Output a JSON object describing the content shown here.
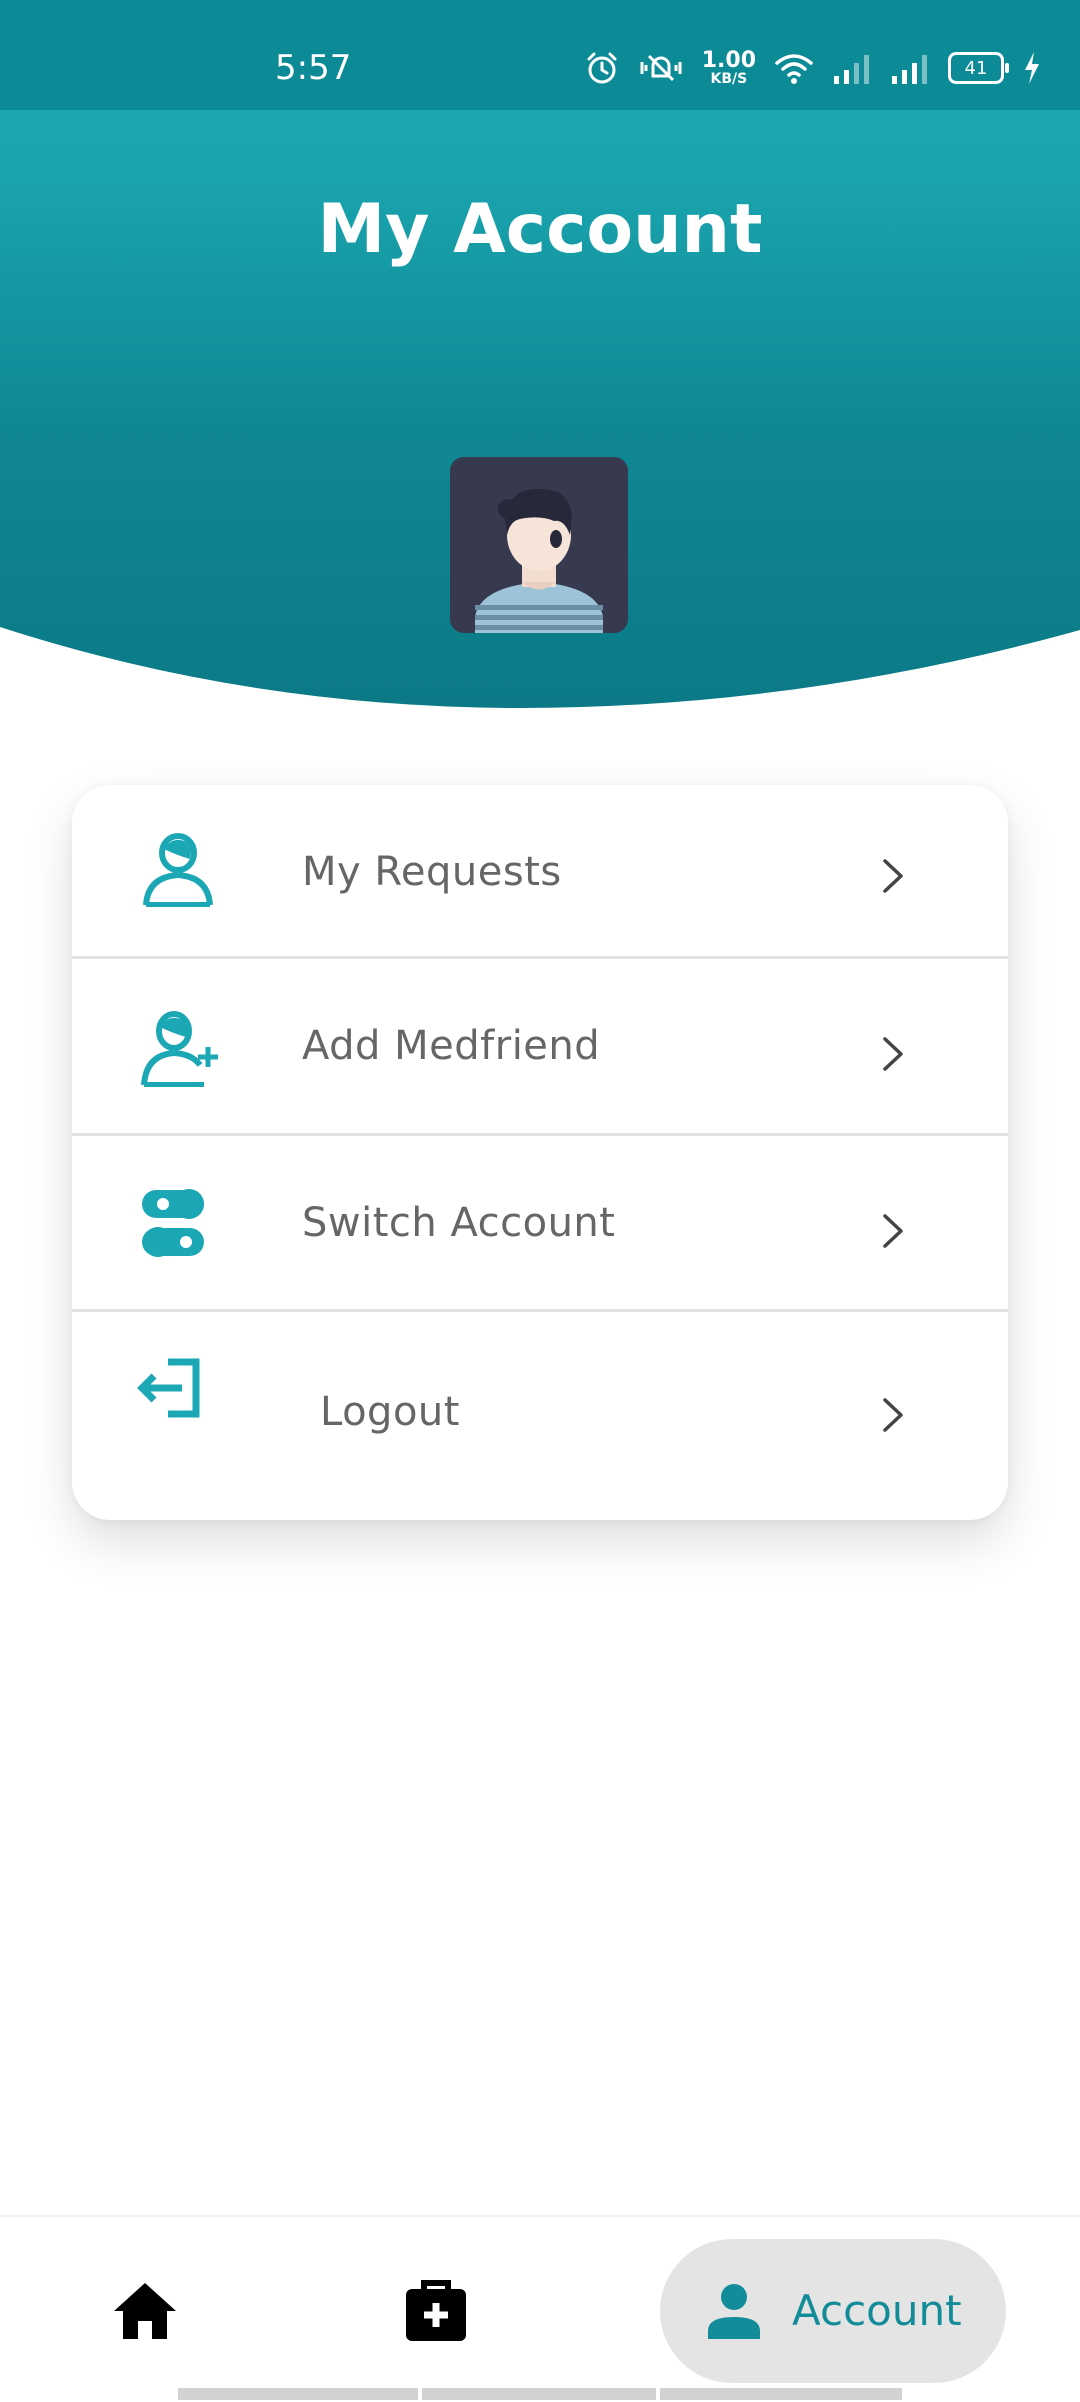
{
  "status_bar": {
    "time": "5:57",
    "net_speed_value": "1.00",
    "net_speed_unit": "KB/S",
    "battery_level": "41"
  },
  "header": {
    "title": "My Account"
  },
  "menu": {
    "items": [
      {
        "label": "My Requests",
        "icon": "user-icon"
      },
      {
        "label": "Add Medfriend",
        "icon": "add-user-icon"
      },
      {
        "label": "Switch Account",
        "icon": "toggle-icon"
      },
      {
        "label": "Logout",
        "icon": "logout-icon"
      }
    ]
  },
  "bottom_nav": {
    "items": [
      {
        "icon": "home-icon"
      },
      {
        "icon": "medical-kit-icon"
      },
      {
        "icon": "person-icon",
        "label": "Account",
        "active": true
      }
    ]
  },
  "colors": {
    "primary": "#1ba8b4",
    "header_dark": "#0c7f8a",
    "text_gray": "#666666",
    "active_pill": "#e4e4e4"
  }
}
